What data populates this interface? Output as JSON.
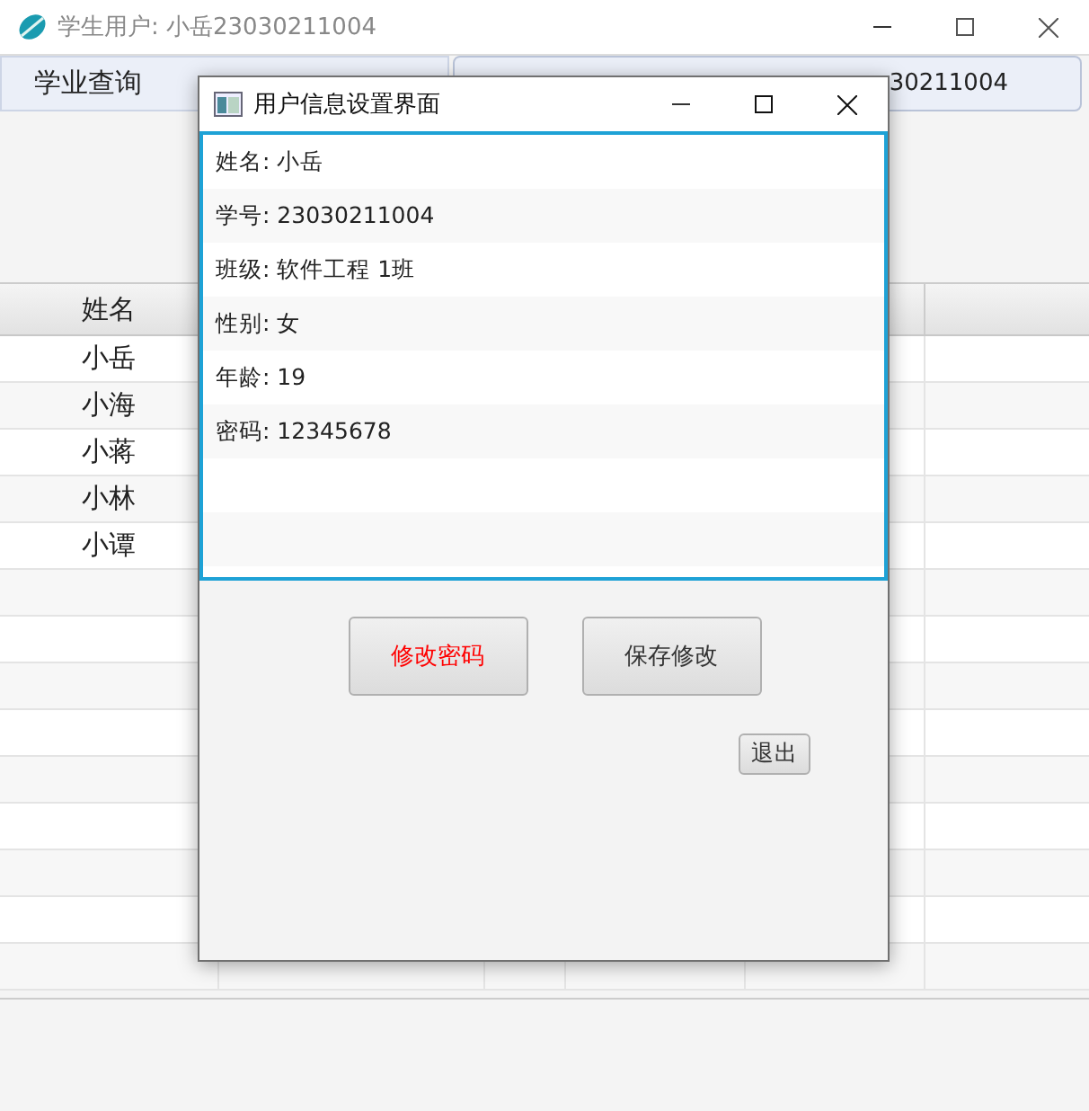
{
  "window": {
    "title": "学生用户: 小岳23030211004"
  },
  "menu": [
    "学业查询"
  ],
  "user_label": "30211004",
  "table": {
    "columns": [
      "姓名"
    ],
    "rows": [
      "小岳",
      "小海",
      "小蒋",
      "小林",
      "小谭"
    ]
  },
  "dialog": {
    "title": "用户信息设置界面",
    "fields": [
      "姓名: 小岳",
      "学号: 23030211004",
      "班级: 软件工程 1班",
      "性别: 女",
      "年龄: 19",
      "密码: 12345678"
    ],
    "buttons": [
      {
        "label": "修改密码",
        "kind": "warning"
      },
      {
        "label": "保存修改",
        "kind": "normal"
      }
    ],
    "exit": "退出"
  }
}
